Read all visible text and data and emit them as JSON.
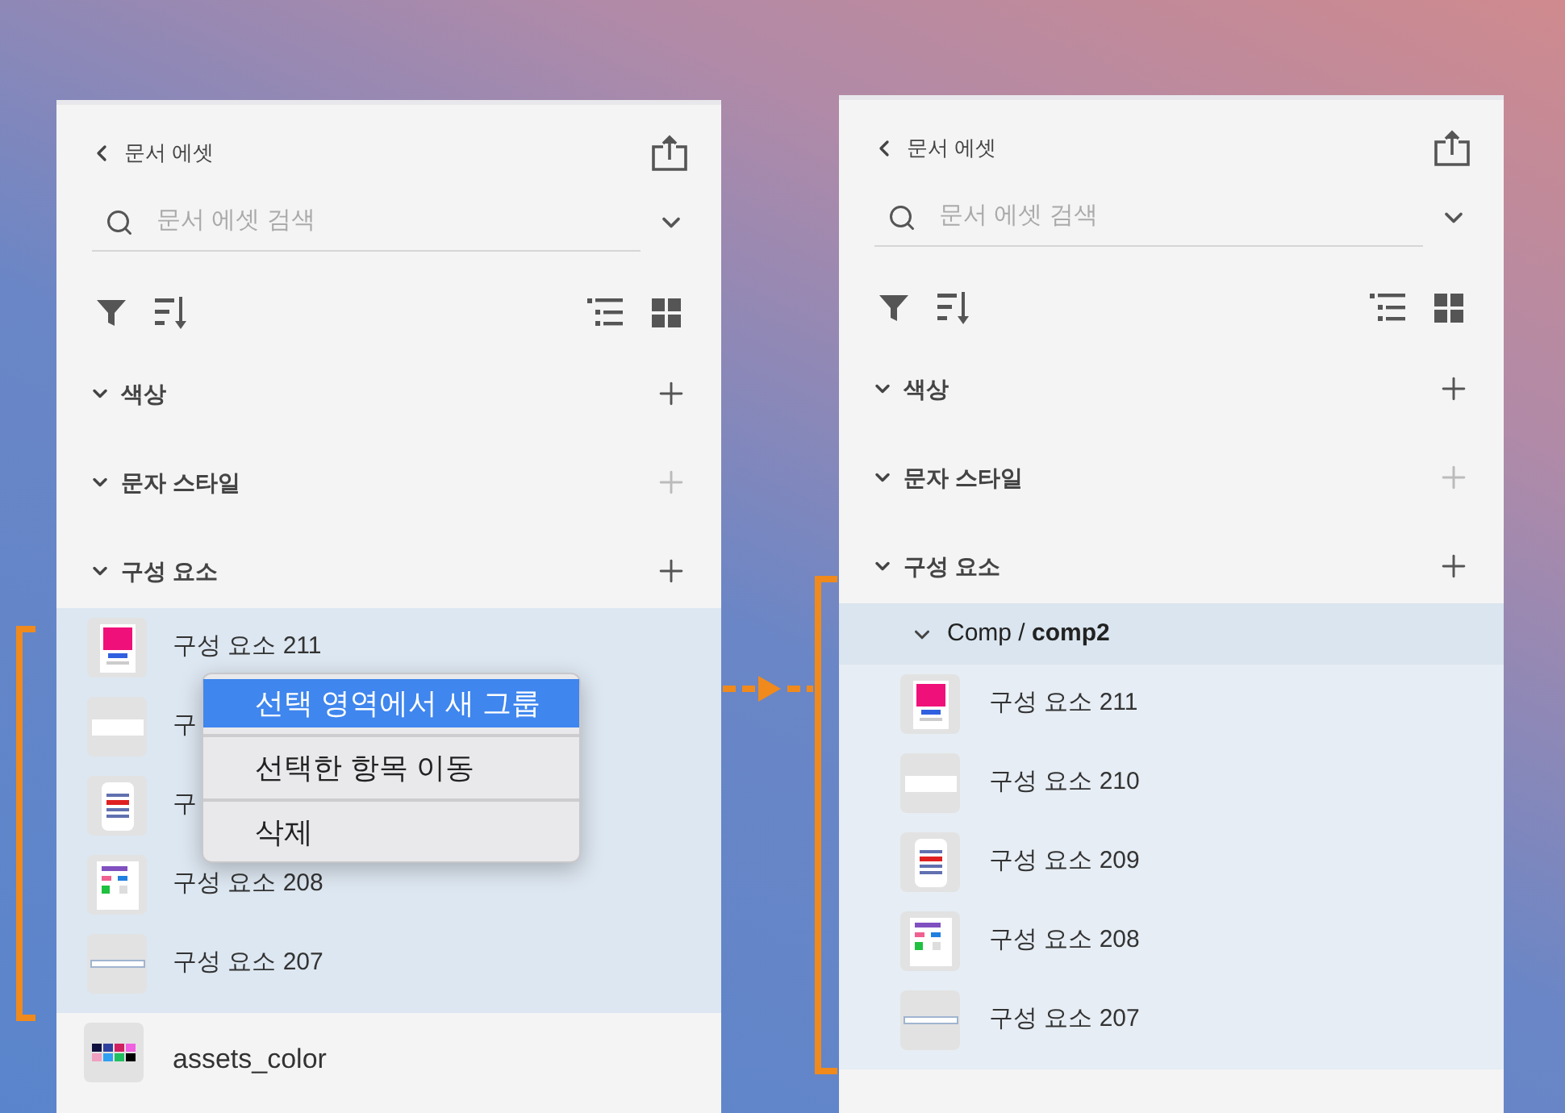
{
  "panels": [
    {
      "header": {
        "title": "문서 에셋"
      },
      "search": {
        "placeholder": "문서 에셋 검색"
      },
      "sections": [
        {
          "label": "색상",
          "expanded": true,
          "add_disabled": false
        },
        {
          "label": "문자 스타일",
          "expanded": true,
          "add_disabled": true
        },
        {
          "label": "구성 요소",
          "expanded": true,
          "add_disabled": false
        }
      ],
      "items": [
        {
          "label": "구성 요소 211",
          "kind": "poster"
        },
        {
          "label": "구",
          "kind": "bar"
        },
        {
          "label": "구",
          "kind": "list"
        },
        {
          "label": "구성 요소 208",
          "kind": "controls"
        },
        {
          "label": "구성 요소 207",
          "kind": "line"
        }
      ],
      "footer_item": {
        "label": "assets_color",
        "kind": "palette"
      },
      "context_menu": {
        "items": [
          {
            "label": "선택 영역에서 새 그룹",
            "selected": true
          },
          {
            "label": "선택한 항목 이동",
            "selected": false
          },
          {
            "label": "삭제",
            "selected": false
          }
        ]
      }
    },
    {
      "header": {
        "title": "문서 에셋"
      },
      "search": {
        "placeholder": "문서 에셋 검색"
      },
      "sections": [
        {
          "label": "색상",
          "expanded": true,
          "add_disabled": false
        },
        {
          "label": "문자 스타일",
          "expanded": true,
          "add_disabled": true
        },
        {
          "label": "구성 요소",
          "expanded": true,
          "add_disabled": false
        }
      ],
      "group": {
        "label": "Comp / **comp2**",
        "expanded": true
      },
      "items": [
        {
          "label": "구성 요소 211",
          "kind": "poster"
        },
        {
          "label": "구성 요소 210",
          "kind": "bar"
        },
        {
          "label": "구성 요소 209",
          "kind": "list"
        },
        {
          "label": "구성 요소 208",
          "kind": "controls"
        },
        {
          "label": "구성 요소 207",
          "kind": "line"
        }
      ]
    }
  ]
}
